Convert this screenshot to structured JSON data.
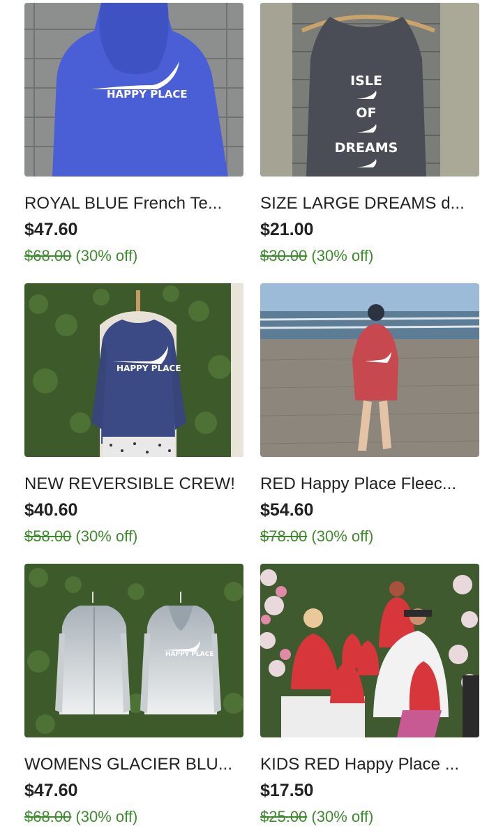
{
  "listings": [
    {
      "title": "ROYAL BLUE French Te...",
      "price": "$47.60",
      "original_price": "$68.00",
      "discount_label": "(30% off)",
      "graphic_text": "HAPPY PLACE",
      "image_alt": "Royal blue zip hoodie with Happy Place print"
    },
    {
      "title": "SIZE LARGE DREAMS d...",
      "price": "$21.00",
      "original_price": "$30.00",
      "discount_label": "(30% off)",
      "graphic_lines": [
        "ISLE",
        "OF",
        "DREAMS"
      ],
      "image_alt": "Charcoal muscle tank reading Isle of Dreams"
    },
    {
      "title": "NEW REVERSIBLE CREW!",
      "price": "$40.60",
      "original_price": "$58.00",
      "discount_label": "(30% off)",
      "graphic_text": "HAPPY PLACE",
      "image_alt": "Navy crew sweatshirt on dress form"
    },
    {
      "title": "RED Happy Place Fleec...",
      "price": "$54.60",
      "original_price": "$78.00",
      "discount_label": "(30% off)",
      "image_alt": "Woman in red hoodie on the beach"
    },
    {
      "title": "WOMENS GLACIER BLU...",
      "price": "$47.60",
      "original_price": "$68.00",
      "discount_label": "(30% off)",
      "graphic_text": "HAPPY PLACE",
      "image_alt": "Two glacier blue ombre hoodies on hangers"
    },
    {
      "title": "KIDS RED Happy Place ...",
      "price": "$17.50",
      "original_price": "$25.00",
      "discount_label": "(30% off)",
      "image_alt": "Family in red hoodies in front of flower wall"
    }
  ],
  "colors": {
    "discount_green": "#3d8b2d",
    "text": "#222222"
  }
}
